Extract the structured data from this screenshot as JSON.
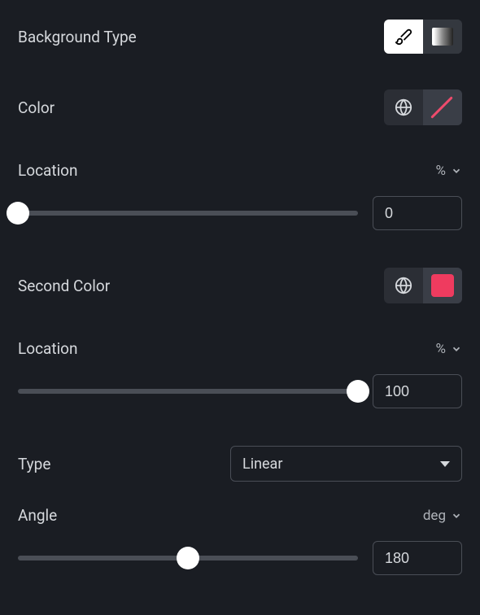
{
  "backgroundType": {
    "label": "Background Type",
    "options": [
      "classic",
      "gradient"
    ],
    "selected": "classic"
  },
  "color1": {
    "label": "Color",
    "value": "none"
  },
  "location1": {
    "label": "Location",
    "unit": "%",
    "value": "0",
    "percent": 0
  },
  "color2": {
    "label": "Second Color",
    "value": "#ef3b5f"
  },
  "location2": {
    "label": "Location",
    "unit": "%",
    "value": "100",
    "percent": 100
  },
  "type": {
    "label": "Type",
    "value": "Linear"
  },
  "angle": {
    "label": "Angle",
    "unit": "deg",
    "value": "180",
    "percent": 50
  }
}
